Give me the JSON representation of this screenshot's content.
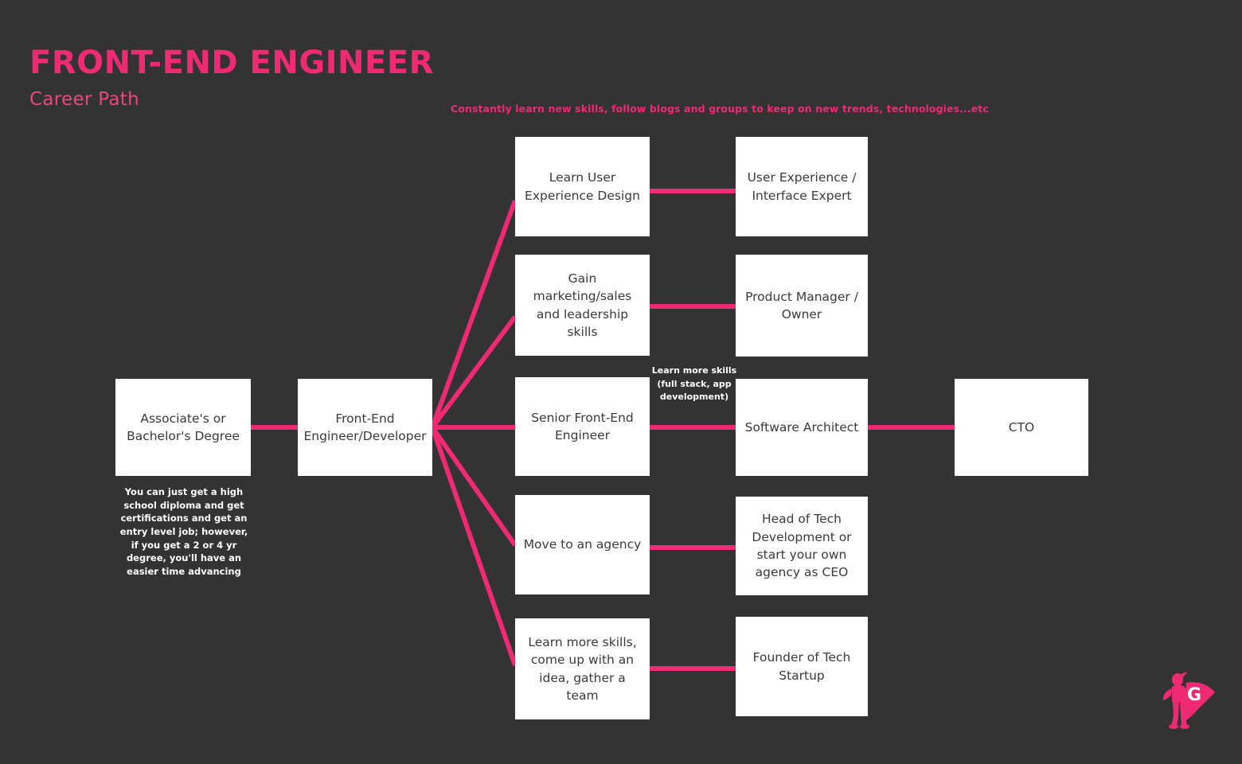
{
  "header": {
    "title": "FRONT-END ENGINEER",
    "subtitle": "Career Path",
    "top_note": "Constantly learn new skills, follow blogs and groups to keep on new trends, technologies...etc"
  },
  "colors": {
    "background": "#333333",
    "accent_pink": "#EE2A72",
    "node_fill": "#FFFFFF",
    "node_text": "#3A3A3A",
    "annotation_text": "#FFFFFF"
  },
  "nodes": {
    "degree": "Associate's or Bachelor's Degree",
    "frontend_engineer": "Front-End Engineer/Developer",
    "learn_ux": "Learn User Experience Design",
    "ux_expert": "User Experience / Interface Expert",
    "gain_marketing": "Gain marketing/sales and leadership skills",
    "product_manager": "Product Manager / Owner",
    "senior_fe": "Senior Front-End Engineer",
    "software_architect": "Software Architect",
    "cto": "CTO",
    "move_agency": "Move to an agency",
    "head_of_tech": "Head of Tech Development or start your own agency as CEO",
    "learn_more_idea": "Learn more skills, come up with an idea, gather a team",
    "founder_startup": "Founder of Tech Startup"
  },
  "annotations": {
    "degree_note": "You can just  get a high school diploma and get certifications and get an entry level job; however, if you get a 2 or 4 yr degree, you'll have an easier time advancing",
    "skills_note": "Learn more skills  (full stack, app development)"
  },
  "logo": {
    "letter": "G",
    "name": "superhero-logo"
  }
}
